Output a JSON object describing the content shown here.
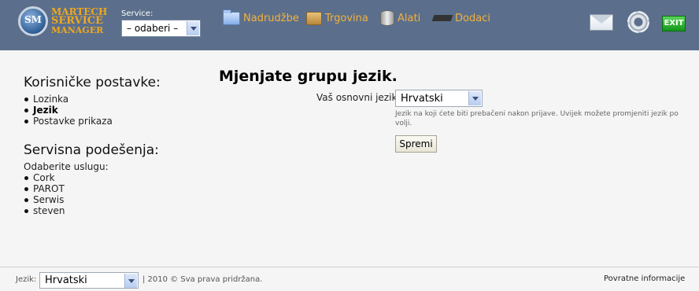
{
  "header": {
    "logo": {
      "line1": "MARTECH",
      "line2": "SERVICE",
      "line3": "MANAGER",
      "badge": "SM"
    },
    "service_label": "Service:",
    "service_select_value": "– odaberi –",
    "nav": {
      "orders": "Nadrudžbe",
      "shop": "Trgovina",
      "tools": "Alati",
      "addons": "Dodaci"
    },
    "exit_label": "EXIT",
    "icons": {
      "orders": "folder-icon",
      "shop": "box-icon",
      "tools": "database-icon",
      "addons": "chip-icon",
      "mail": "mail-icon",
      "settings": "gear-icon",
      "exit": "exit-icon"
    }
  },
  "sidebar": {
    "user_settings_title": "Korisničke postavke:",
    "user_items": [
      "Lozinka",
      "Jezik",
      "Postavke prikaza"
    ],
    "active_item": "Jezik",
    "service_settings_title": "Servisna podešenja:",
    "choose_service_label": "Odaberite uslugu:",
    "services": [
      "Cork",
      "PAROT",
      "Serwis",
      "steven"
    ]
  },
  "main": {
    "title": "Mjenjate grupu jezik.",
    "language_label": "Vaš osnovni jezik:",
    "language_value": "Hrvatski",
    "help_text": "Jezik na koji ćete biti prebačeni nakon prijave. Uvijek možete promjeniti jezik po volji.",
    "save_label": "Spremi"
  },
  "footer": {
    "language_label": "Jezik:",
    "language_value": "Hrvatski",
    "copyright": "| 2010 © Sva prava pridržana.",
    "feedback_link": "Povratne informacije"
  },
  "colors": {
    "header_bg": "#5b6f8c",
    "nav_text": "#f3b13c",
    "logo_text": "#f0a81e",
    "page_bg": "#f5f5f5"
  }
}
